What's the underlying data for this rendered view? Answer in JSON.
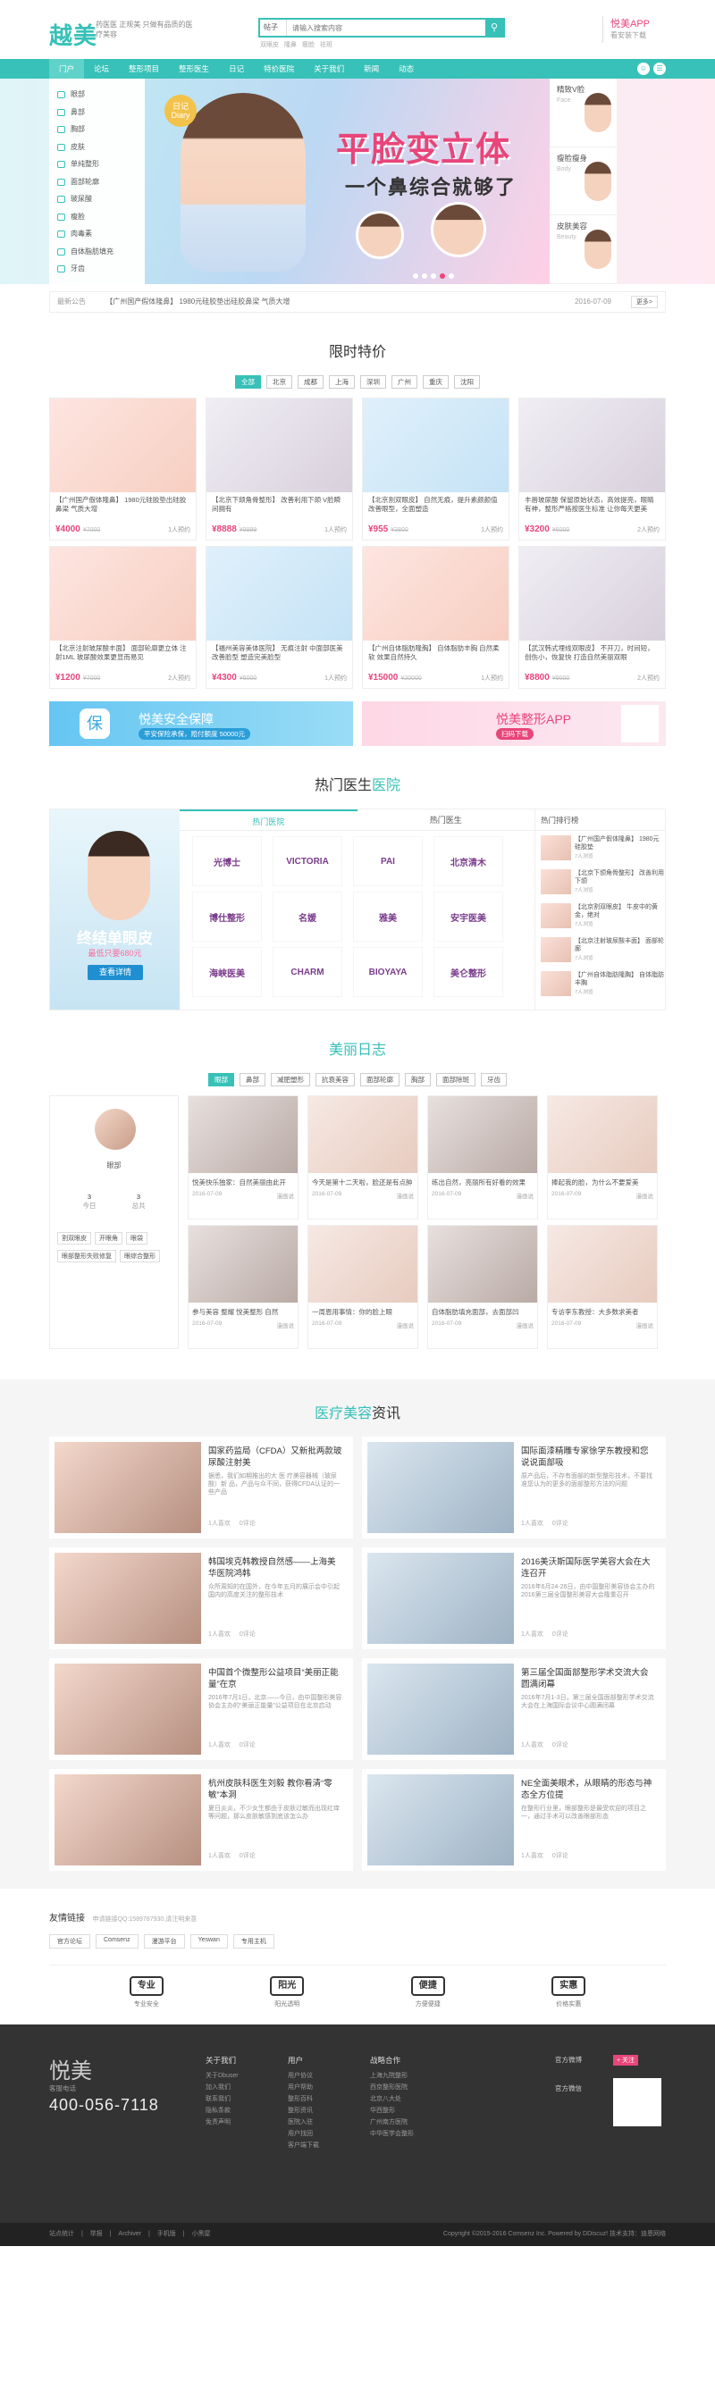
{
  "header": {
    "logo": "越美",
    "slogan": "药医医 正规美 只做有品质的医疗美容",
    "search_select": "帖子",
    "search_placeholder": "请输入搜索内容",
    "search_icon": "search-icon",
    "hot_words": "双眼皮 隆鼻 瘦脸 祛斑",
    "app_title": "悦美APP",
    "app_sub": "看安装下载"
  },
  "nav": {
    "items": [
      "门户",
      "论坛",
      "整形项目",
      "整形医生",
      "日记",
      "特价医院",
      "关于我们",
      "新闻",
      "动态"
    ]
  },
  "sidebar": {
    "items": [
      "眼部",
      "鼻部",
      "胸部",
      "皮肤",
      "单纯整形",
      "面部轮廓",
      "玻尿酸",
      "瘦脸",
      "肉毒素",
      "自体脂肪填充",
      "牙齿"
    ]
  },
  "banner": {
    "tag": "日记 Diary",
    "title": "平脸变立体",
    "subtitle": "一个鼻综合就够了"
  },
  "right_panel": [
    {
      "title": "精致V脸",
      "sub": "Face"
    },
    {
      "title": "瘦脸瘦身",
      "sub": "Body"
    },
    {
      "title": "皮肤美容",
      "sub": "Beauty"
    }
  ],
  "ticker": {
    "label": "最新公告",
    "text": "【广州国产假体隆鼻】 1980元硅胶垫出硅胶鼻梁 气质大增",
    "date": "2016-07-09",
    "more": "更多>"
  },
  "specials": {
    "title_a": "限时",
    "title_b": "特价",
    "filters": [
      "全部",
      "北京",
      "成都",
      "上海",
      "深圳",
      "广州",
      "重庆",
      "沈阳"
    ],
    "cards": [
      {
        "t": "【广州国产假体隆鼻】 1980元硅胶垫出硅胶鼻梁 气质大增",
        "p": "¥4000",
        "o": "¥7000",
        "c": "1人预约"
      },
      {
        "t": "【北京下颌角骨整形】 改善利用下颌 V脸瞬间拥有",
        "p": "¥8888",
        "o": "¥9999",
        "c": "1人预约"
      },
      {
        "t": "【北京割双眼皮】 自然无痕，提升素颜颜值改善眼型，全面塑造",
        "p": "¥955",
        "o": "¥3800",
        "c": "1人预约"
      },
      {
        "t": "丰唇玻尿酸 保留原始状态，高效提亮，眼睛有神，整形严格按医生标准 让你每天更美",
        "p": "¥3200",
        "o": "¥6000",
        "c": "2人预约"
      },
      {
        "t": "【北京注射玻尿酸丰面】 面部轮廓更立体 注射1ML 玻尿酸效果更显而易见",
        "p": "¥1200",
        "o": "¥7000",
        "c": "2人预约"
      },
      {
        "t": "【福州美容美体医院】 无痕注射 中面部医美 改善脸型 塑造完美脸型",
        "p": "¥4300",
        "o": "¥6000",
        "c": "1人预约"
      },
      {
        "t": "【广州自体脂肪隆胸】 自体脂肪丰胸 自然柔软 效果自然持久",
        "p": "¥15000",
        "o": "¥20000",
        "c": "1人预约"
      },
      {
        "t": "【武汉韩式埋线双眼皮】 不开刀，时间短，创伤小，恢复快 打造自然美丽双眼",
        "p": "¥8800",
        "o": "¥9000",
        "c": "2人预约"
      }
    ]
  },
  "promo": {
    "left_title": "悦美安全保障",
    "left_sub": "平安保险承保，赔付额度 50000元",
    "left_icon": "保",
    "right_title": "悦美整形APP",
    "right_sub": "扫码下载"
  },
  "hospital": {
    "title_a": "热门",
    "title_b": "医生",
    "title_c": "医院",
    "ad_title": "终结单眼皮",
    "ad_price": "最低只要680元",
    "ad_btn": "查看详情",
    "tabs": [
      "热门医院",
      "热门医生"
    ],
    "logos": [
      "光博士",
      "VICTORIA",
      "PAI",
      "北京清木",
      "博仕整形",
      "名媛",
      "雅美",
      "安宇医美",
      "海峡医美",
      "CHARM",
      "BIOYAYA",
      "美仑整形"
    ],
    "rank_title": "热门排行榜",
    "rank": [
      {
        "t": "【广州国产假体隆鼻】 1980元硅胶垫",
        "c": "7人浏览"
      },
      {
        "t": "【北京下颌角骨整形】 改善利用下颌",
        "c": "7人浏览"
      },
      {
        "t": "【北京割双眼皮】 牛皮中的黄金，绝对",
        "c": "7人浏览"
      },
      {
        "t": "【北京注射玻尿酸丰面】 面部轮廓",
        "c": "7人浏览"
      },
      {
        "t": "【广州自体脂肪隆胸】 自体脂肪丰胸",
        "c": "7人浏览"
      }
    ]
  },
  "diary": {
    "title": "美丽日志",
    "filters": [
      "眼部",
      "鼻部",
      "减肥塑形",
      "抗衰美容",
      "面部轮廓",
      "胸部",
      "面部除斑",
      "牙齿"
    ],
    "profile": {
      "name": "眼部",
      "stat1_v": "3",
      "stat1_l": "今日",
      "stat2_v": "3",
      "stat2_l": "总共",
      "tags": [
        "割双眼皮",
        "开眼角",
        "眼袋",
        "眼部整形失败修复",
        "眼综合整形"
      ]
    },
    "cards": [
      {
        "t": "悦美快乐独家：自然美丽由此开",
        "d": "2016-07-09",
        "a": "漫画说"
      },
      {
        "t": "今天是第十二天啦，脸还是有点肿",
        "d": "2016-07-09",
        "a": "漫画说"
      },
      {
        "t": "练出自然，亮丽所有好看的效果",
        "d": "2016-07-09",
        "a": "漫画说"
      },
      {
        "t": "捧起我的脸，为什么不要爱美",
        "d": "2016-07-09",
        "a": "漫画说"
      },
      {
        "t": "参与美容 整耀 悦美整形 自然",
        "d": "2016-07-09",
        "a": "漫画说"
      },
      {
        "t": "一周恩用事情：你的脸上眼",
        "d": "2016-07-09",
        "a": "漫画说"
      },
      {
        "t": "自体脂肪填充面部，去面部凹",
        "d": "2016-07-09",
        "a": "漫画说"
      },
      {
        "t": "专访李东教授：大多数求美者",
        "d": "2016-07-09",
        "a": "漫画说"
      }
    ]
  },
  "articles": {
    "title_a": "医疗美容",
    "title_b": "资讯",
    "items": [
      {
        "t": "国家药监局（CFDA）又新批两款玻尿酸注射美",
        "d": "据悉，我们如期推出的大 医 疗美容器械（玻尿酸）新 品，产品与众不同，获得CFDA认证的一些产品",
        "m": "1人喜欢 0评论"
      },
      {
        "t": "国际面漆精雕专家徐学东教授和您说说面部吸",
        "d": "原产品后，不存有面部的新型整形技术，不要找准您认为的更多的面部整形方法的问题",
        "m": "1人喜欢 0评论"
      },
      {
        "t": "韩国埃克韩教授自然感——上海美华医院鸿韩",
        "d": "众所周知的在国外，在今年五月的展示会中引起国内的高度关注的整形技术",
        "m": "1人喜欢 0评论"
      },
      {
        "t": "2016美沃斯国际医学美容大会在大连召开",
        "d": "2016年6月24-26日，由中国整形美容协会主办的2016第三届全国整形美容大会隆重召开",
        "m": "1人喜欢 0评论"
      },
      {
        "t": "中国首个微整形公益项目“美丽正能量”在京",
        "d": "2016年7月1日，北京——今日，由中国整形美容协会主办的“美丽正能量”公益项目在北京启动",
        "m": "1人喜欢 0评论"
      },
      {
        "t": "第三届全国面部整形学术交流大会圆满闭幕",
        "d": "2016年7月1-3日，第三届全国面部整形学术交流大会在上海国际会议中心圆满闭幕",
        "m": "1人喜欢 0评论"
      },
      {
        "t": "杭州皮肤科医生刘毅 教你看清“零敏”本洞",
        "d": "夏日炎炎，不少女生都由于皮肤过敏而出现红痒等问题，那么皮肤敏感到底该怎么办",
        "m": "1人喜欢 0评论"
      },
      {
        "t": "NE全面美眼术，从眼睛的形态与神态全方位提",
        "d": "在整形行业里，眼部整形是最受欢迎的项目之一，通过手术可以改善眼部形态",
        "m": "1人喜欢 0评论"
      }
    ]
  },
  "links": {
    "title": "友情链接",
    "contact": "申请链接QQ:1589787930,请注明来意",
    "items": [
      "官方论坛",
      "Comsenz",
      "漫游平台",
      "Yeswan",
      "专用主机"
    ]
  },
  "guarantees": [
    {
      "b": "专业",
      "s": "专业安全"
    },
    {
      "b": "阳光",
      "s": "阳光透明"
    },
    {
      "b": "便捷",
      "s": "方便便捷"
    },
    {
      "b": "实惠",
      "s": "价格实惠"
    }
  ],
  "footer": {
    "logo": "悦美",
    "contact_label": "客服电话",
    "phone": "400-056-7118",
    "col1": {
      "title": "关于我们",
      "items": [
        "关于Dbuser",
        "加入我们",
        "联系我们",
        "隐私条款",
        "免责声明"
      ]
    },
    "col2": {
      "title": "用户",
      "items": [
        "用户协议",
        "用户帮助",
        "整形百科",
        "整形资讯",
        "医院入驻",
        "用户找回",
        "客户端下载"
      ]
    },
    "col3": {
      "title": "战略合作",
      "items": [
        "上海九院整形",
        "西京整形医院",
        "北京八大处",
        "华西整形",
        "广州南方医院",
        "中华医学会整形"
      ]
    },
    "social1": "官方微博",
    "social2": "官方微信",
    "weibo_btn": "+ 关注",
    "bottom_left": "站点统计 | 举报 | Archiver | 手机版 | 小黑屋",
    "bottom_right": "Copyright  ©2015-2016 Comsenz Inc. Powered by DDiscuz!  技术支持：迪恩网络"
  }
}
